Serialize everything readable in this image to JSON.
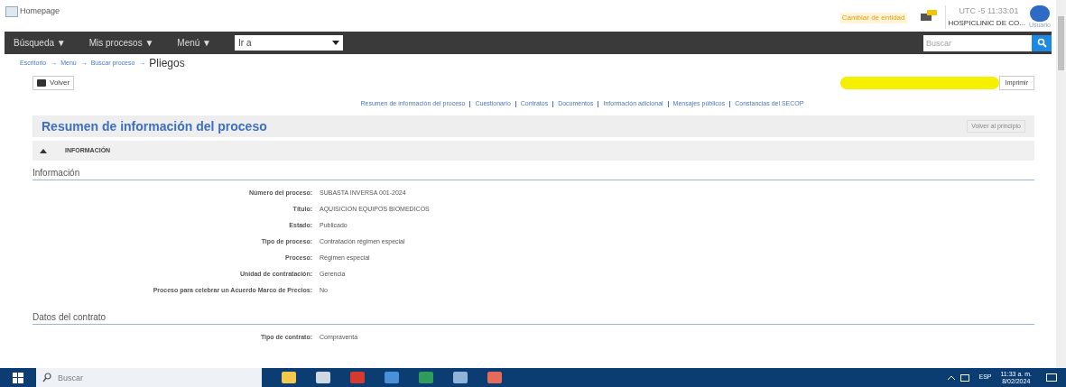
{
  "header": {
    "logo_alt": "Homepage",
    "entity_link": "Cambiar de entidad",
    "clock": "UTC -5 11:33:01",
    "user": "HOSPICLINIC DE CO...",
    "user_caption": "Usuario"
  },
  "nav": {
    "menus": [
      "Búsqueda ▼",
      "Mis procesos ▼",
      "Menú ▼"
    ],
    "goto": {
      "value": "Ir a"
    },
    "search": {
      "placeholder": "Buscar"
    }
  },
  "breadcrumb": {
    "links": [
      "Escritorio",
      "Menú",
      "Buscar proceso"
    ],
    "separator": "→",
    "current": "Pliegos"
  },
  "back_button": "Volver",
  "print_button": "Imprimir",
  "section_links": [
    "Resumen de información del proceso",
    "Cuestionario",
    "Contratos",
    "Documentos",
    "Información adicional",
    "Mensajes públicos",
    "Constancias del SECOP"
  ],
  "panel": {
    "title": "Resumen de información del proceso",
    "top_button": "Volver al principio",
    "collapsible": {
      "label": "INFORMACIÓN",
      "expanded": true
    }
  },
  "sections": [
    {
      "title": "Información",
      "fields": [
        {
          "label": "Número del proceso:",
          "value": "SUBASTA INVERSA 001-2024"
        },
        {
          "label": "Título:",
          "value": "AQUISICION EQUIPOS BIOMEDICOS"
        },
        {
          "label": "Estado:",
          "value": "Publicado"
        },
        {
          "label": "Tipo de proceso:",
          "value": "Contratación régimen especial"
        },
        {
          "label": "Proceso:",
          "value": "Régimen especial"
        },
        {
          "label": "Unidad de contratación:",
          "value": "Gerencia"
        },
        {
          "label": "Proceso para celebrar un Acuerdo Marco de Precios:",
          "value": "No"
        }
      ]
    },
    {
      "title": "Datos del contrato",
      "fields": [
        {
          "label": "Tipo de contrato:",
          "value": "Compraventa"
        }
      ]
    }
  ],
  "taskbar": {
    "search": {
      "placeholder": "Buscar"
    },
    "language": "ESP",
    "time": "11:33 a. m.",
    "date": "8/02/2024"
  }
}
